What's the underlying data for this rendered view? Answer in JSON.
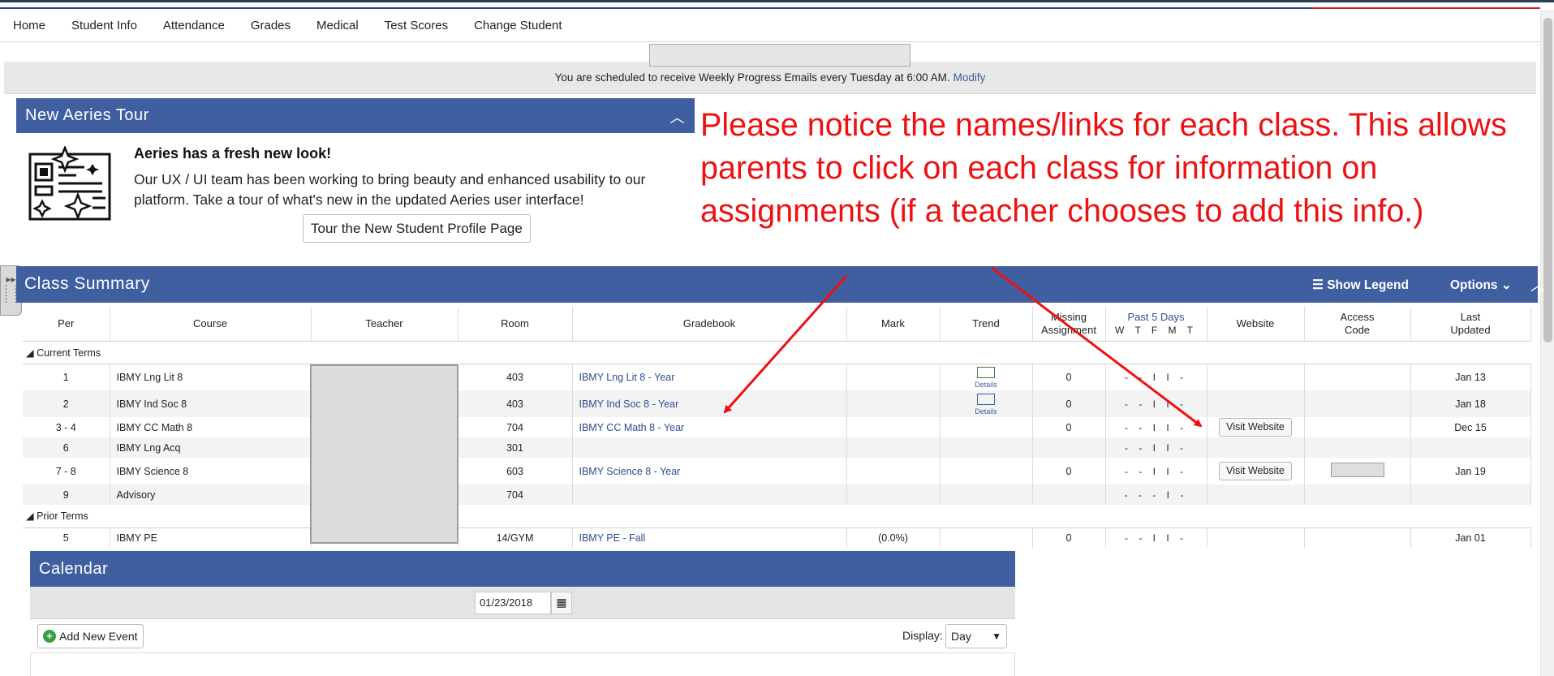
{
  "nav": {
    "items": [
      "Home",
      "Student Info",
      "Attendance",
      "Grades",
      "Medical",
      "Test Scores",
      "Change Student"
    ]
  },
  "email_bar": {
    "text": "You are scheduled to receive Weekly Progress Emails every Tuesday at 6:00 AM.",
    "link": "Modify"
  },
  "tour": {
    "header": "New Aeries Tour",
    "title": "Aeries has a fresh new look!",
    "text": "Our UX / UI team has been working to bring beauty and enhanced usability to our platform. Take a tour of what's new in the updated Aeries user interface!",
    "button": "Tour the New Student Profile Page"
  },
  "annotation": {
    "text": "Please notice the names/links for each class.  This allows parents to click on each class for information on assignments (if a teacher chooses to add this info.)",
    "color": "#ee1111"
  },
  "class_summary": {
    "title": "Class Summary",
    "show_legend": "Show Legend",
    "options": "Options",
    "columns": {
      "per": "Per",
      "course": "Course",
      "teacher": "Teacher",
      "room": "Room",
      "gradebook": "Gradebook",
      "mark": "Mark",
      "trend": "Trend",
      "missing_1": "Missing",
      "missing_2": "Assignment",
      "past5": "Past 5 Days",
      "past5_days": "W T F M T",
      "website": "Website",
      "access_1": "Access",
      "access_2": "Code",
      "last_1": "Last",
      "last_2": "Updated"
    },
    "group_current": "Current Terms",
    "group_prior": "Prior Terms",
    "trend_label": "Details",
    "visit_label": "Visit Website",
    "rows": [
      {
        "per": "1",
        "course": "IBMY Lng Lit 8",
        "room": "403",
        "gradebook": "IBMY Lng Lit 8 - Year",
        "mark": "",
        "missing": "0",
        "past5": "- - I I -",
        "updated": "Jan 13"
      },
      {
        "per": "2",
        "course": "IBMY Ind Soc 8",
        "room": "403",
        "gradebook": "IBMY Ind Soc 8 - Year",
        "mark": "",
        "missing": "0",
        "past5": "- - I I -",
        "updated": "Jan 18"
      },
      {
        "per": "3 - 4",
        "course": "IBMY CC Math 8",
        "room": "704",
        "gradebook": "IBMY CC Math 8 - Year",
        "mark": "",
        "missing": "0",
        "past5": "- - I I -",
        "updated": "Dec 15"
      },
      {
        "per": "6",
        "course": "IBMY Lng Acq",
        "room": "301",
        "gradebook": "",
        "mark": "",
        "missing": "",
        "past5": "- - I I -",
        "updated": ""
      },
      {
        "per": "7 - 8",
        "course": "IBMY Science 8",
        "room": "603",
        "gradebook": "IBMY Science 8 - Year",
        "mark": "",
        "missing": "0",
        "past5": "- - I I -",
        "updated": "Jan 19"
      },
      {
        "per": "9",
        "course": "Advisory",
        "room": "704",
        "gradebook": "",
        "mark": "",
        "missing": "",
        "past5": "- - - I -",
        "updated": ""
      }
    ],
    "prior_rows": [
      {
        "per": "5",
        "course": "IBMY PE",
        "room": "14/GYM",
        "gradebook": "IBMY PE - Fall",
        "mark": "(0.0%)",
        "missing": "0",
        "past5": "- - I I -",
        "updated": "Jan 01"
      }
    ]
  },
  "calendar": {
    "title": "Calendar",
    "date": "01/23/2018",
    "add_event": "Add New Event",
    "display_label": "Display:",
    "display_value": "Day"
  },
  "colors": {
    "header_blue": "#3f5fa0",
    "link_blue": "#2f4d8f",
    "annotation_red": "#ee1111"
  }
}
